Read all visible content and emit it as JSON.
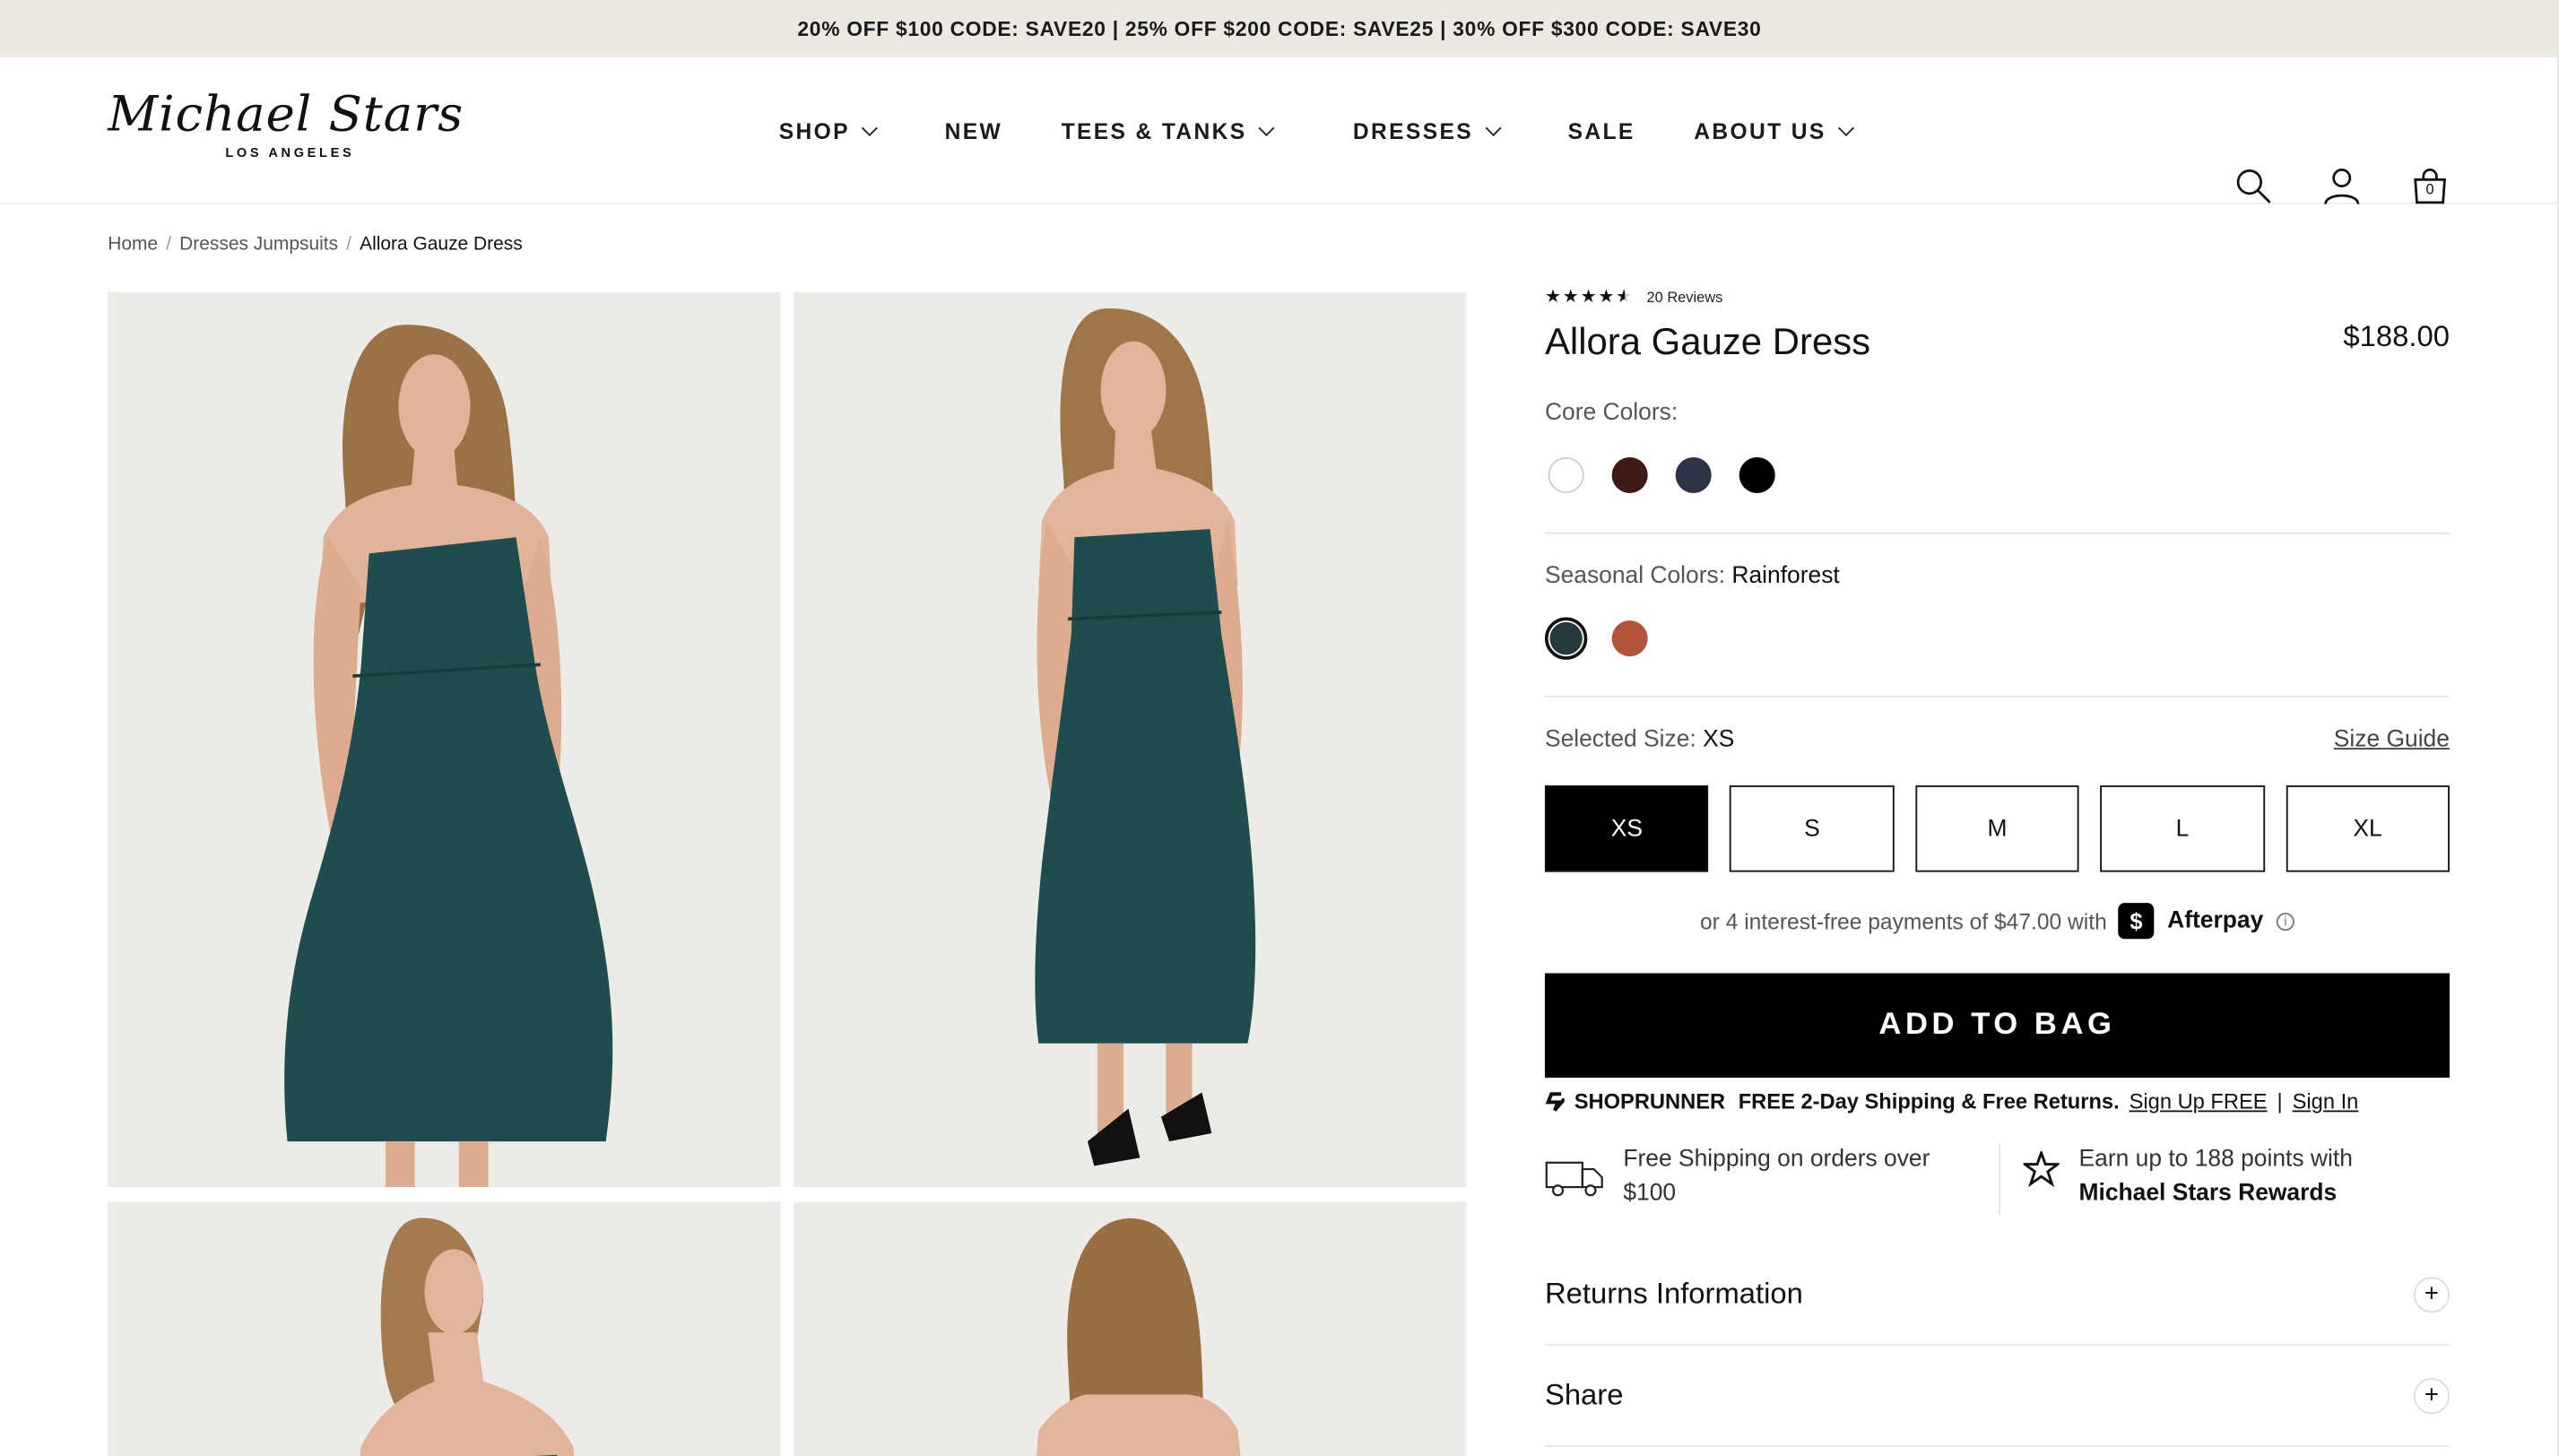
{
  "promo": {
    "text": "20% OFF $100 CODE: SAVE20 | 25% OFF $200 CODE: SAVE25 | 30% OFF $300 CODE: SAVE30"
  },
  "logo": {
    "script": "Michael Stars",
    "sub": "LOS ANGELES"
  },
  "nav": {
    "shop": "SHOP",
    "new": "NEW",
    "tees": "TEES & TANKS",
    "dresses": "DRESSES",
    "sale": "SALE",
    "about": "ABOUT US"
  },
  "cart": {
    "count": "0"
  },
  "breadcrumb": {
    "home": "Home",
    "category": "Dresses Jumpsuits",
    "current": "Allora Gauze Dress",
    "sep": "/"
  },
  "product": {
    "stars": "★★★★★",
    "reviews": "20 Reviews",
    "rating": 4.5,
    "title": "Allora Gauze Dress",
    "price": "$188.00",
    "core_colors_label": "Core Colors:",
    "core_colors": [
      "#ffffff",
      "#3e1a16",
      "#2d3347",
      "#000000"
    ],
    "seasonal_colors_label": "Seasonal Colors:",
    "seasonal_selected": "Rainforest",
    "seasonal_colors": [
      "#24393a",
      "#b3543a"
    ],
    "size_label": "Selected Size:",
    "size_selected": "XS",
    "size_guide": "Size Guide",
    "sizes": [
      "XS",
      "S",
      "M",
      "L",
      "XL"
    ],
    "afterpay_text": "or 4 interest-free payments of $47.00 with",
    "afterpay_brand": "Afterpay",
    "afterpay_badge": "$",
    "add_to_bag": "ADD TO BAG",
    "shoprunner": "SHOPRUNNER",
    "shoprunner_offer": "FREE 2-Day Shipping & Free Returns.",
    "shoprunner_signup": "Sign Up FREE",
    "shoprunner_sep": "|",
    "shoprunner_signin": "Sign In",
    "perk_shipping_line1": "Free Shipping on orders over",
    "perk_shipping_line2": "$100",
    "perk_points_line1": "Earn up to 188 points with",
    "perk_points_line2": "Michael Stars Rewards",
    "accordion_returns": "Returns Information",
    "accordion_share": "Share",
    "accordion_icon": "+"
  },
  "colors": {
    "accent": "#000000",
    "promo_bg": "#ece8e2",
    "photo_bg": "#ececea",
    "dress": "#1f4b4b"
  }
}
